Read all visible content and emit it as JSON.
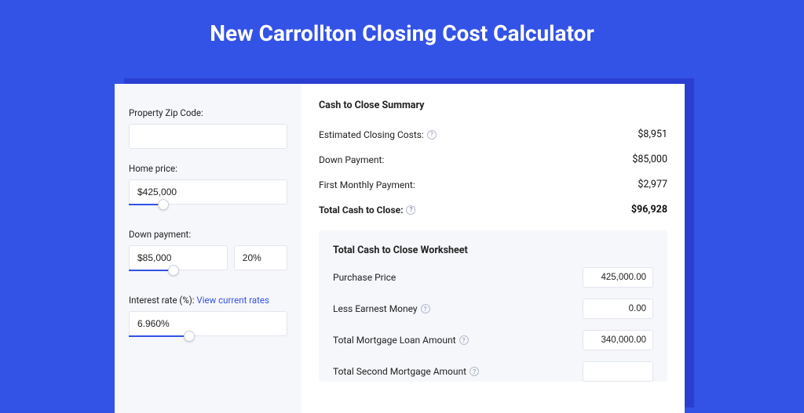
{
  "title": "New Carrollton Closing Cost Calculator",
  "sidebar": {
    "zip_label": "Property Zip Code:",
    "zip_value": "",
    "home_price_label": "Home price:",
    "home_price_value": "$425,000",
    "home_price_slider_pct": 22,
    "down_payment_label": "Down payment:",
    "down_payment_value": "$85,000",
    "down_payment_pct_value": "20%",
    "down_payment_slider_pct": 28,
    "interest_label": "Interest rate (%): ",
    "interest_link": "View current rates",
    "interest_value": "6.960%",
    "interest_slider_pct": 38
  },
  "summary": {
    "heading": "Cash to Close Summary",
    "rows": [
      {
        "label": "Estimated Closing Costs:",
        "help": true,
        "value": "$8,951"
      },
      {
        "label": "Down Payment:",
        "help": false,
        "value": "$85,000"
      },
      {
        "label": "First Monthly Payment:",
        "help": false,
        "value": "$2,977"
      }
    ],
    "total_label": "Total Cash to Close:",
    "total_value": "$96,928"
  },
  "worksheet": {
    "heading": "Total Cash to Close Worksheet",
    "rows": [
      {
        "label": "Purchase Price",
        "help": false,
        "value": "425,000.00"
      },
      {
        "label": "Less Earnest Money",
        "help": true,
        "value": "0.00"
      },
      {
        "label": "Total Mortgage Loan Amount",
        "help": true,
        "value": "340,000.00"
      },
      {
        "label": "Total Second Mortgage Amount",
        "help": true,
        "value": ""
      }
    ]
  }
}
